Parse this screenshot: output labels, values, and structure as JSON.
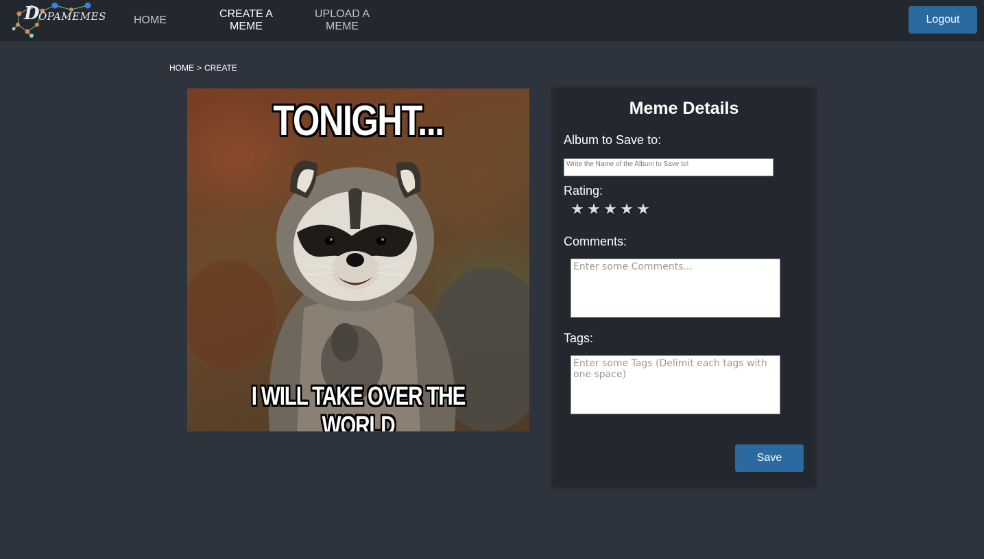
{
  "app": {
    "logo_letter": "D",
    "logo_text": "OPAMEMES",
    "colors": {
      "navbar": "#23272e",
      "background": "#2e343d",
      "accent": "#2a6aa0"
    }
  },
  "nav": {
    "items": [
      {
        "label": "HOME",
        "active": false
      },
      {
        "label": "CREATE A MEME",
        "active": true
      },
      {
        "label": "UPLOAD A MEME",
        "active": false
      }
    ],
    "logout_label": "Logout"
  },
  "breadcrumb": {
    "home": "HOME",
    "separator": ">",
    "current": "CREATE"
  },
  "meme": {
    "top_text": "TONIGHT...",
    "bottom_text": "I WILL TAKE OVER THE WORLD"
  },
  "details": {
    "title": "Meme Details",
    "album_label": "Album to Save to:",
    "album_placeholder": "Write the Name of the Album to Save to!",
    "rating_label": "Rating:",
    "rating_value": 0,
    "rating_max": 5,
    "star_glyph": "★",
    "comments_label": "Comments:",
    "comments_placeholder": "Enter some Comments...",
    "tags_label": "Tags:",
    "tags_placeholder": "Enter some Tags (Delimit each tags with one space)",
    "save_label": "Save"
  }
}
